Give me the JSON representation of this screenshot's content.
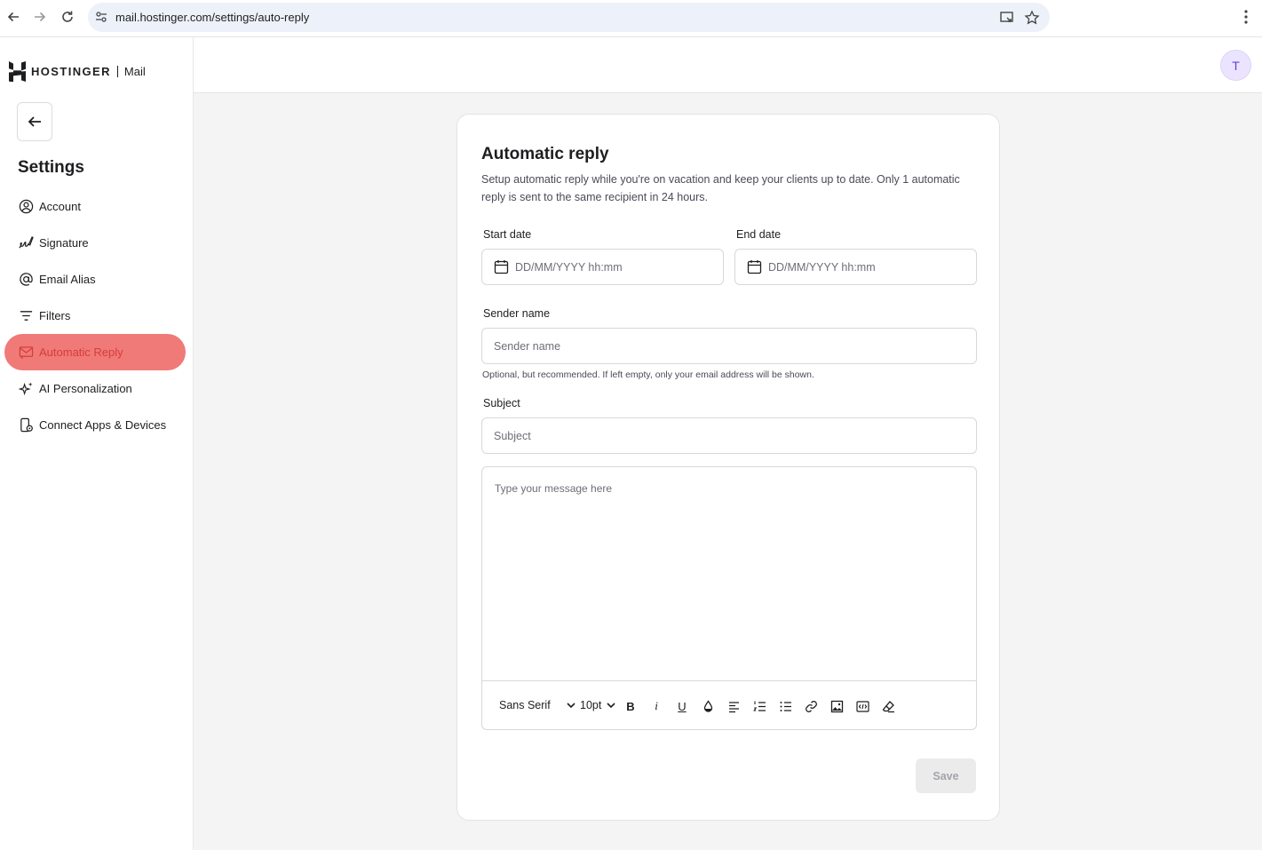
{
  "browser": {
    "url": "mail.hostinger.com/settings/auto-reply",
    "icons": [
      "back-arrow-icon",
      "forward-arrow-icon",
      "reload-icon",
      "site-settings-icon",
      "cast-icon",
      "bookmark-star-icon",
      "more-vert-icon"
    ]
  },
  "sidebar": {
    "brand": "HOSTINGER",
    "product": "Mail",
    "title": "Settings",
    "items": [
      {
        "label": "Account",
        "icon": "account-circle-icon",
        "active": false
      },
      {
        "label": "Signature",
        "icon": "signature-icon",
        "active": false
      },
      {
        "label": "Email Alias",
        "icon": "at-sign-icon",
        "active": false
      },
      {
        "label": "Filters",
        "icon": "filter-icon",
        "active": false
      },
      {
        "label": "Automatic Reply",
        "icon": "mail-reply-icon",
        "active": true
      },
      {
        "label": "AI Personalization",
        "icon": "sparkle-icon",
        "active": false
      },
      {
        "label": "Connect Apps & Devices",
        "icon": "device-connect-icon",
        "active": false
      }
    ]
  },
  "header": {
    "avatar_initial": "T"
  },
  "form": {
    "title": "Automatic reply",
    "description": "Setup automatic reply while you're on vacation and keep your clients up to date. Only 1 automatic reply is sent to the same recipient in 24 hours.",
    "start_date_label": "Start date",
    "start_date_placeholder": "DD/MM/YYYY hh:mm",
    "end_date_label": "End date",
    "end_date_placeholder": "DD/MM/YYYY hh:mm",
    "sender_name_label": "Sender name",
    "sender_name_placeholder": "Sender name",
    "sender_name_hint": "Optional, but recommended. If left empty, only your email address will be shown.",
    "subject_label": "Subject",
    "subject_placeholder": "Subject",
    "message_placeholder": "Type your message here",
    "toolbar": {
      "font_family": "Sans Serif",
      "font_size": "10pt",
      "bold_glyph": "B",
      "italic_glyph": "i",
      "underline_glyph": "U"
    },
    "save_label": "Save"
  },
  "colors": {
    "active_item_bg": "#f07a77",
    "active_item_text": "#d63c3c",
    "avatar_bg": "#ebe4ff",
    "avatar_text": "#673de6",
    "main_bg": "#f4f4f5"
  }
}
